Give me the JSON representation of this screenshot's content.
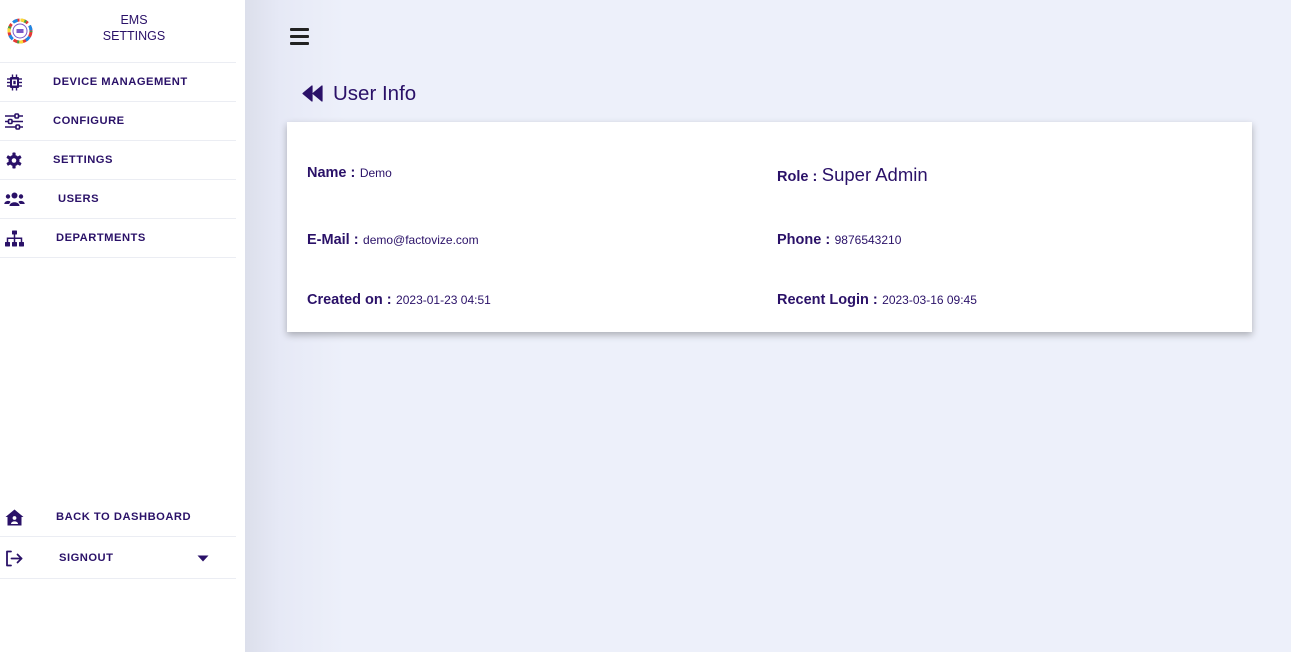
{
  "brand": {
    "line1": "EMS",
    "line2": "SETTINGS"
  },
  "sidebar": {
    "items": [
      {
        "label": "DEVICE MANAGEMENT",
        "icon": "cpu-chip-icon"
      },
      {
        "label": "CONFIGURE",
        "icon": "sliders-icon"
      },
      {
        "label": "SETTINGS",
        "icon": "gear-icon"
      },
      {
        "label": "USERS",
        "icon": "users-icon"
      },
      {
        "label": "DEPARTMENTS",
        "icon": "sitemap-icon"
      }
    ],
    "bottom": [
      {
        "label": "BACK TO DASHBOARD",
        "icon": "house-user-icon"
      },
      {
        "label": "SIGNOUT",
        "icon": "sign-out-icon"
      }
    ]
  },
  "page": {
    "title": "User Info"
  },
  "user": {
    "name_label": "Name :",
    "name": "Demo",
    "role_label": "Role :",
    "role": "Super Admin",
    "email_label": "E-Mail :",
    "email": "demo@factovize.com",
    "phone_label": "Phone :",
    "phone": "9876543210",
    "created_label": "Created on :",
    "created": "2023-01-23 04:51",
    "login_label": "Recent Login :",
    "login": "2023-03-16 09:45"
  },
  "colors": {
    "primary": "#2a1168",
    "background": "#edf0fa",
    "card": "#ffffff"
  }
}
